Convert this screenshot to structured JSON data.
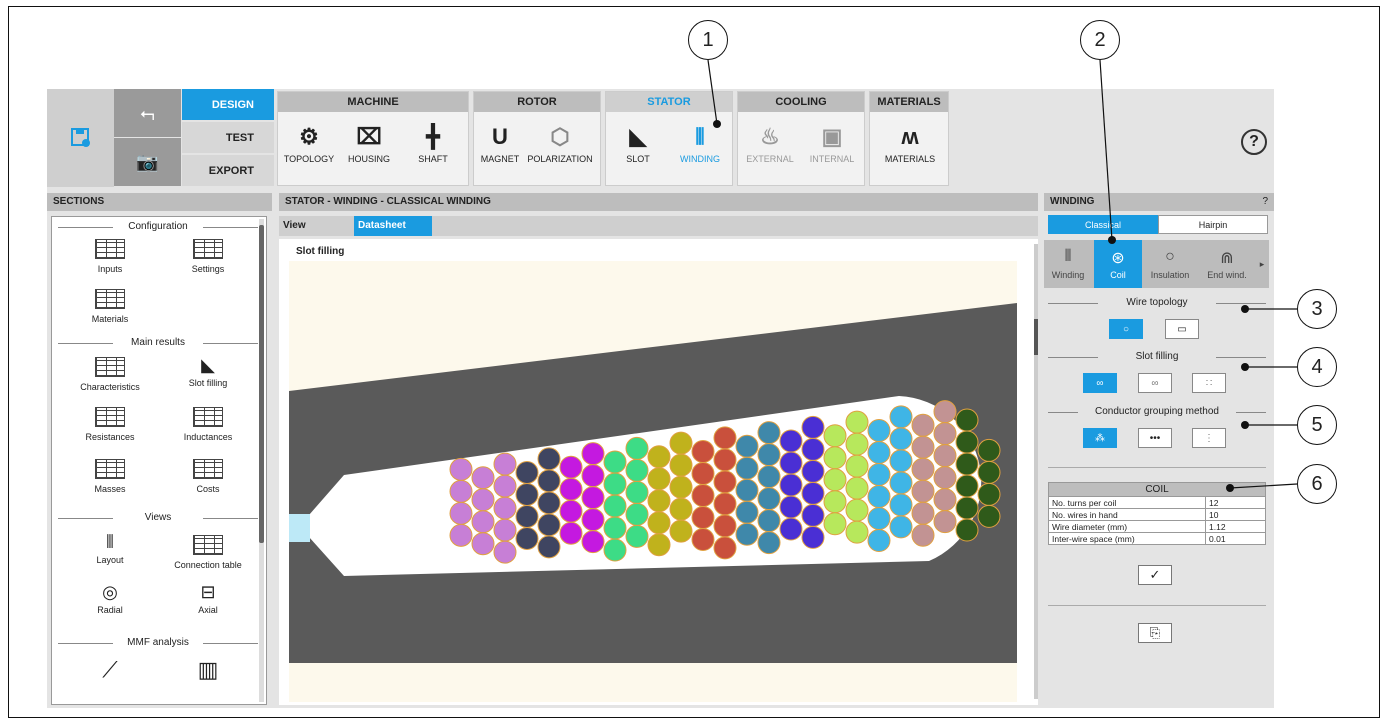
{
  "modes": [
    "DESIGN",
    "TEST",
    "EXPORT"
  ],
  "ribbon": {
    "machine": {
      "title": "MACHINE",
      "tools": [
        "TOPOLOGY",
        "HOUSING",
        "SHAFT"
      ]
    },
    "rotor": {
      "title": "ROTOR",
      "tools": [
        "MAGNET",
        "POLARIZATION"
      ]
    },
    "stator": {
      "title": "STATOR",
      "tools": [
        "SLOT",
        "WINDING"
      ]
    },
    "cooling": {
      "title": "COOLING",
      "tools": [
        "EXTERNAL",
        "INTERNAL"
      ]
    },
    "materials": {
      "title": "MATERIALS",
      "tools": [
        "MATERIALS"
      ]
    },
    "help": "?"
  },
  "sections": {
    "title": "SECTIONS",
    "configuration": "Configuration",
    "config_items": [
      "Inputs",
      "Settings",
      "Materials"
    ],
    "main_results": "Main results",
    "result_items": [
      "Characteristics",
      "Slot filling",
      "Resistances",
      "Inductances",
      "Masses",
      "Costs"
    ],
    "views": "Views",
    "view_items": [
      "Layout",
      "Connection table",
      "Radial",
      "Axial"
    ],
    "mmf": "MMF analysis"
  },
  "center": {
    "title": "STATOR - WINDING - CLASSICAL WINDING",
    "view_tab": "View",
    "datasheet_tab": "Datasheet",
    "slot_label": "Slot filling"
  },
  "winding": {
    "title": "WINDING",
    "help": "?",
    "tabs": [
      "Classical",
      "Hairpin"
    ],
    "subtabs": [
      "Winding",
      "Coil",
      "Insulation",
      "End wind."
    ],
    "wire_topology": "Wire topology",
    "slot_filling": "Slot filling",
    "grouping": "Conductor grouping method",
    "coil_table": {
      "header": "COIL",
      "rows": [
        {
          "label": "No. turns per coil",
          "value": "12"
        },
        {
          "label": "No. wires in hand",
          "value": "10"
        },
        {
          "label": "Wire diameter (mm)",
          "value": "1.12"
        },
        {
          "label": "Inter-wire space (mm)",
          "value": "0.01"
        }
      ]
    }
  },
  "callouts": [
    "1",
    "2",
    "3",
    "4",
    "5",
    "6"
  ],
  "colors": {
    "accent": "#1a9be0",
    "slot_dark": "#5a5a5a",
    "canvas_bg": "#fdf9ec"
  },
  "conductor_colors": [
    "#c77fd6",
    "#3f4561",
    "#c419e0",
    "#3ddc86",
    "#c0b21c",
    "#c9503c",
    "#3f88aa",
    "#4a2fd4",
    "#b7e85c",
    "#3fb5e6",
    "#c29393",
    "#2f5a1a"
  ]
}
